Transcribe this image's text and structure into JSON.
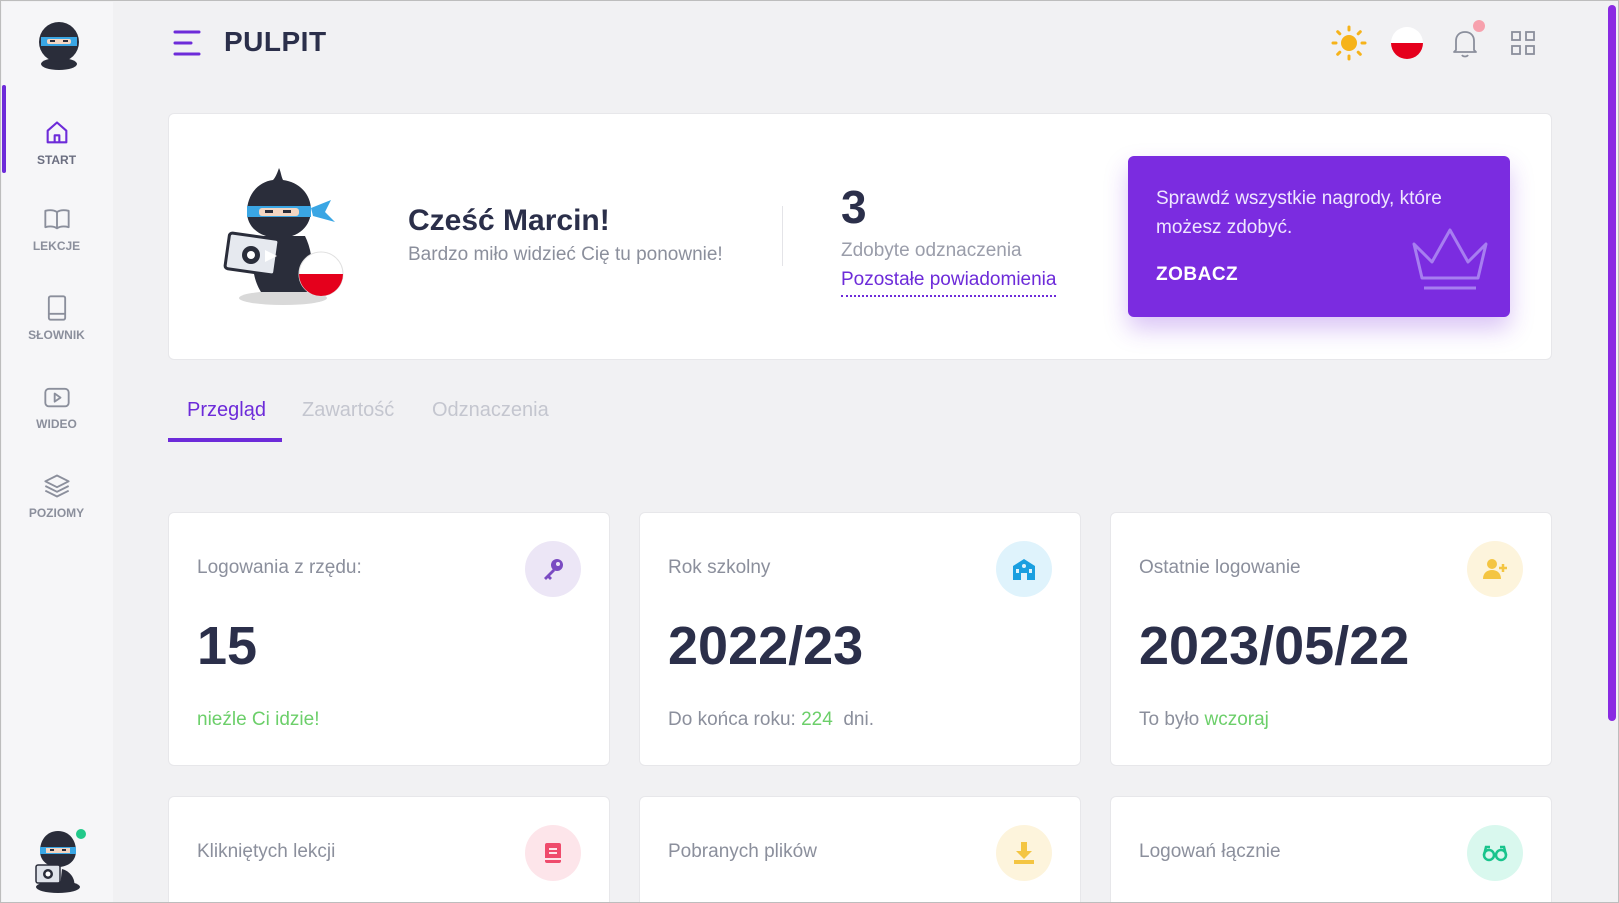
{
  "header": {
    "title": "PULPIT",
    "icons": [
      "menu-icon",
      "sun-icon",
      "poland-flag-icon",
      "bell-icon",
      "grid-icon"
    ]
  },
  "sidebar": {
    "items": [
      {
        "label": "START",
        "icon": "home-icon",
        "active": true
      },
      {
        "label": "LEKCJE",
        "icon": "book-open-icon"
      },
      {
        "label": "SŁOWNIK",
        "icon": "book-icon"
      },
      {
        "label": "WIDEO",
        "icon": "video-icon"
      },
      {
        "label": "POZIOMY",
        "icon": "layers-icon"
      }
    ]
  },
  "welcome": {
    "greeting": "Cześć Marcin!",
    "subtitle": "Bardzo miło widzieć Cię tu ponownie!",
    "badge_count": "3",
    "badge_label": "Zdobyte odznaczenia",
    "badge_link": "Pozostałe powiadomienia",
    "promo_text": "Sprawdź wszystkie nagrody, które możesz zdobyć.",
    "promo_cta": "ZOBACZ"
  },
  "tabs": [
    {
      "label": "Przegląd",
      "active": true
    },
    {
      "label": "Zawartość"
    },
    {
      "label": "Odznaczenia"
    }
  ],
  "stats": [
    {
      "title": "Logowania z rzędu:",
      "value": "15",
      "note_prefix": "",
      "note_highlight": "nieźle Ci idzie!",
      "note_suffix": "",
      "icon": "key-icon",
      "icon_bg": "#ece6f6",
      "icon_color": "#7a4bc2"
    },
    {
      "title": "Rok szkolny",
      "value": "2022/23",
      "note_prefix": "Do końca roku:",
      "note_highlight": "224",
      "note_suffix": "dni.",
      "icon": "school-icon",
      "icon_bg": "#dff3fc",
      "icon_color": "#1a9fe0"
    },
    {
      "title": "Ostatnie logowanie",
      "value": "2023/05/22",
      "note_prefix": "To było",
      "note_highlight": "wczoraj",
      "note_suffix": "",
      "icon": "user-plus-icon",
      "icon_bg": "#fdf4dc",
      "icon_color": "#f4c542"
    },
    {
      "title": "Klikniętych lekcji",
      "icon": "lesson-book-icon",
      "icon_bg": "#fde5ea",
      "icon_color": "#ef4b6c"
    },
    {
      "title": "Pobranych plików",
      "icon": "download-icon",
      "icon_bg": "#fdf4dc",
      "icon_color": "#f4c542"
    },
    {
      "title": "Logowań łącznie",
      "icon": "glasses-icon",
      "icon_bg": "#d9f8ee",
      "icon_color": "#19c48c"
    }
  ],
  "colors": {
    "accent": "#6d2bd9",
    "promo_bg": "#7b2ce0",
    "positive": "#6ccf6a"
  }
}
